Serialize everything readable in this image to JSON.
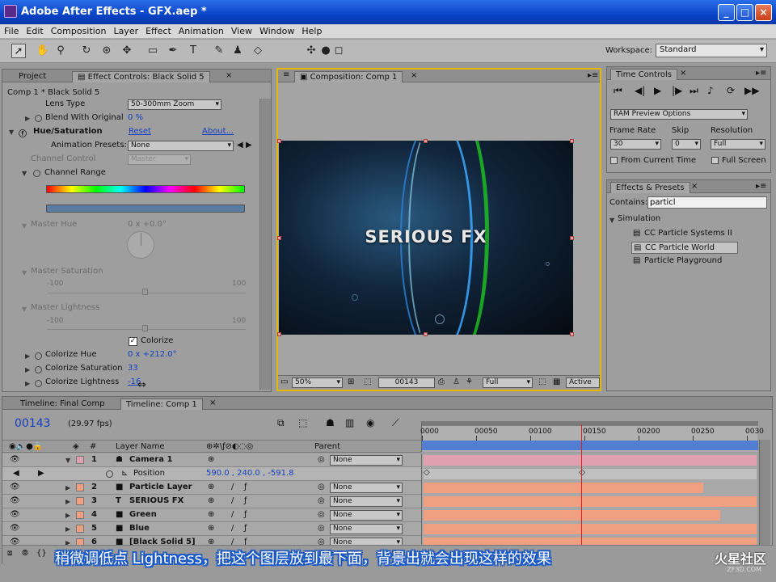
{
  "window": {
    "title": "Adobe After Effects - GFX.aep *"
  },
  "menu": [
    "File",
    "Edit",
    "Composition",
    "Layer",
    "Effect",
    "Animation",
    "View",
    "Window",
    "Help"
  ],
  "toolbar": {
    "tools": [
      "selection-tool-icon",
      "hand-tool-icon",
      "zoom-tool-icon",
      "rotation-tool-icon",
      "orbit-camera-icon",
      "track-xy-camera-icon",
      "rectangle-mask-icon",
      "pen-tool-icon",
      "type-tool-icon",
      "brush-tool-icon",
      "clone-stamp-icon",
      "eraser-icon"
    ],
    "workspace_label": "Workspace:",
    "workspace_value": "Standard"
  },
  "project_tabs": {
    "project": "Project",
    "effect_controls": "Effect Controls: Black Solid 5"
  },
  "effect_controls": {
    "layer_label": "Comp 1 * Black Solid 5",
    "lens_type": {
      "label": "Lens Type",
      "value": "50-300mm Zoom"
    },
    "blend_with_original": {
      "label": "Blend With Original",
      "value": "0 %"
    },
    "hue_saturation": {
      "label": "Hue/Saturation",
      "reset": "Reset",
      "about": "About..."
    },
    "animation_presets": {
      "label": "Animation Presets:",
      "value": "None"
    },
    "channel_control": {
      "label": "Channel Control",
      "value": "Master"
    },
    "channel_range": {
      "label": "Channel Range"
    },
    "master_hue": {
      "label": "Master Hue",
      "value": "0 x +0.0°"
    },
    "master_saturation": {
      "label": "Master Saturation",
      "min": "-100",
      "max": "100"
    },
    "master_lightness": {
      "label": "Master Lightness",
      "min": "-100",
      "max": "100"
    },
    "colorize": {
      "label": "Colorize",
      "checked": true
    },
    "colorize_hue": {
      "label": "Colorize Hue",
      "value": "0 x +212.0°"
    },
    "colorize_saturation": {
      "label": "Colorize Saturation",
      "value": "33"
    },
    "colorize_lightness": {
      "label": "Colorize Lightness",
      "value": "-16"
    }
  },
  "composition": {
    "tab": "Composition: Comp 1",
    "viewer_text": "SERIOUS FX",
    "zoom": "50%",
    "timecode": "00143",
    "resolution": "Full",
    "camera": "Active C"
  },
  "time_controls": {
    "tab": "Time Controls",
    "ram_preview": "RAM Preview Options",
    "frame_rate_label": "Frame Rate",
    "frame_rate": "30",
    "skip_label": "Skip",
    "skip": "0",
    "resolution_label": "Resolution",
    "resolution": "Full",
    "from_current": "From Current Time",
    "full_screen": "Full Screen"
  },
  "effects_presets": {
    "tab": "Effects & Presets",
    "contains_label": "Contains:",
    "contains_value": "particl",
    "category": "Simulation",
    "items": [
      "CC Particle Systems II",
      "CC Particle World",
      "Particle Playground"
    ],
    "selected_index": 1
  },
  "timeline": {
    "tabs": [
      "Timeline: Final Comp",
      "Timeline: Comp 1"
    ],
    "timecode": "00143",
    "fps": "(29.97 fps)",
    "headers": {
      "num": "#",
      "layer_name": "Layer Name",
      "parent": "Parent"
    },
    "ruler": [
      "0000",
      "00050",
      "00100",
      "00150",
      "00200",
      "00250",
      "0030"
    ],
    "current_frame": 143,
    "layers": [
      {
        "num": "1",
        "name": "Camera 1",
        "parent": "None",
        "type": "camera",
        "color": "#e0a0b0",
        "end": 1.0
      },
      {
        "num": "",
        "name": "Position",
        "parent": "",
        "type": "prop",
        "value": "590.0 , 240.0 , -591.8"
      },
      {
        "num": "2",
        "name": "Particle Layer",
        "parent": "None",
        "type": "solid",
        "color": "#f0a080",
        "end": 0.84
      },
      {
        "num": "3",
        "name": "SERIOUS FX",
        "parent": "None",
        "type": "text",
        "color": "#f0a080",
        "end": 1.0
      },
      {
        "num": "4",
        "name": "Green",
        "parent": "None",
        "type": "solid",
        "color": "#f0a080",
        "end": 0.89
      },
      {
        "num": "5",
        "name": "Blue",
        "parent": "None",
        "type": "solid",
        "color": "#f0a080",
        "end": 1.0
      },
      {
        "num": "6",
        "name": "[Black Solid 5]",
        "parent": "None",
        "type": "solid",
        "color": "#f0a080",
        "end": 1.0
      }
    ]
  },
  "overlay": {
    "subtitle": "稍微调低点 Lightness，把这个图层放到最下面，背景出就会出现这样的效果",
    "logo": "火星社区",
    "logo_sub": "ZF3D.COM"
  }
}
